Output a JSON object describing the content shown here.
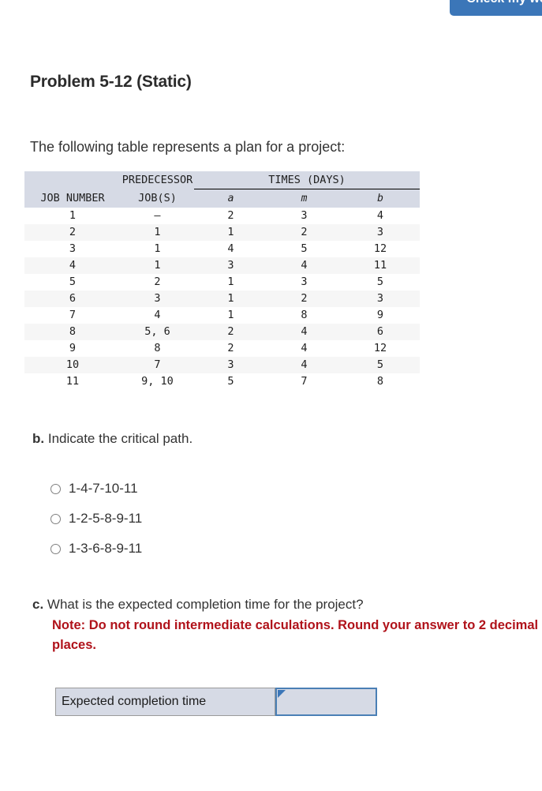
{
  "toolbar": {
    "check_work_label": "Check my work"
  },
  "header": {
    "title": "Problem 5-12 (Static)"
  },
  "intro": {
    "text": "The following table represents a plan for a project:"
  },
  "table": {
    "group_headers": {
      "predecessor": "PREDECESSOR",
      "times": "TIMES (DAYS)"
    },
    "columns": [
      "JOB NUMBER",
      "JOB(S)",
      "a",
      "m",
      "b"
    ],
    "rows": [
      [
        "1",
        "–",
        "2",
        "3",
        "4"
      ],
      [
        "2",
        "1",
        "1",
        "2",
        "3"
      ],
      [
        "3",
        "1",
        "4",
        "5",
        "12"
      ],
      [
        "4",
        "1",
        "3",
        "4",
        "11"
      ],
      [
        "5",
        "2",
        "1",
        "3",
        "5"
      ],
      [
        "6",
        "3",
        "1",
        "2",
        "3"
      ],
      [
        "7",
        "4",
        "1",
        "8",
        "9"
      ],
      [
        "8",
        "5, 6",
        "2",
        "4",
        "6"
      ],
      [
        "9",
        "8",
        "2",
        "4",
        "12"
      ],
      [
        "10",
        "7",
        "3",
        "4",
        "5"
      ],
      [
        "11",
        "9, 10",
        "5",
        "7",
        "8"
      ]
    ]
  },
  "part_b": {
    "label": "b.",
    "question": "Indicate the critical path.",
    "choices": [
      {
        "label": "1-4-7-10-11",
        "selected": false
      },
      {
        "label": "1-2-5-8-9-11",
        "selected": false
      },
      {
        "label": "1-3-6-8-9-11",
        "selected": false
      }
    ]
  },
  "part_c": {
    "label": "c.",
    "question": "What is the expected completion time for the project?",
    "note": "Note: Do not round intermediate calculations. Round your answer to 2 decimal places.",
    "answer_label": "Expected completion time",
    "answer_value": "",
    "answer_placeholder": ""
  },
  "colors": {
    "accent_blue": "#3b76b8",
    "note_red": "#b0121a",
    "table_header_bg": "#d6dae5",
    "row_stripe": "#f6f6f6",
    "input_border": "#4a7fb5"
  }
}
